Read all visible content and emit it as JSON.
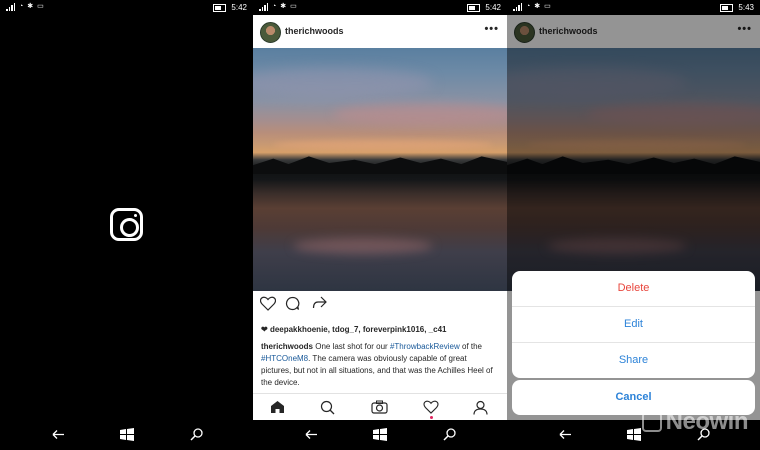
{
  "screens": [
    {
      "status": {
        "time": "5:42"
      },
      "app_icon": "instagram-icon"
    },
    {
      "status": {
        "time": "5:42"
      },
      "post": {
        "username": "therichwoods",
        "likes": "deepakkhoenie, tdog_7, foreverpink1016, _c41",
        "caption_user": "therichwoods",
        "caption_part1": " One last shot for our ",
        "caption_tag1": "#ThrowbackReview",
        "caption_part2": " of the ",
        "caption_tag2": "#HTCOneM8",
        "caption_part3": ". The camera was obviously capable of great pictures, but not in all situations, and that was the Achilles Heel of the device."
      }
    },
    {
      "status": {
        "time": "5:43"
      },
      "post": {
        "username": "therichwoods"
      },
      "menu": {
        "delete": "Delete",
        "edit": "Edit",
        "share": "Share",
        "cancel": "Cancel"
      },
      "watermark": "Neowin"
    }
  ],
  "colors": {
    "link": "#2d83d8",
    "destructive": "#e8463d",
    "hashtag": "#1a5a9a"
  }
}
